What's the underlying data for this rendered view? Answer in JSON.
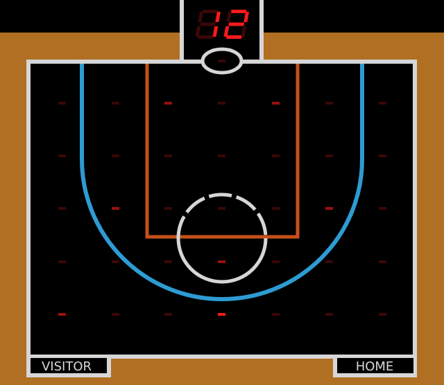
{
  "scoreboard": {
    "digits": [
      "1",
      "2"
    ],
    "lit_color": "#ff1a1a",
    "unlit_color": "#3a0707"
  },
  "teams": {
    "visitor_label": "VISITOR",
    "home_label": "HOME"
  },
  "colors": {
    "floor": "#b06f22",
    "court": "#000000",
    "boundary": "#d6d6d6",
    "three_point_arc": "#2e9bd3",
    "key_lane": "#c5501a",
    "led_dim": "#3a0707",
    "led_mid": "#9a1010",
    "led_bright": "#ff1a1a"
  },
  "led_grid": {
    "rows": [
      [
        "off",
        "off",
        "mid",
        "off",
        "mid",
        "off",
        "off"
      ],
      [
        "off",
        "off",
        "off",
        "off",
        "off",
        "off",
        "off"
      ],
      [
        "off",
        "mid",
        "off",
        "off",
        "off",
        "mid",
        "off"
      ],
      [
        "off",
        "off",
        "off",
        "mid",
        "off",
        "off",
        "off"
      ],
      [
        "mid",
        "off",
        "off",
        "bright",
        "off",
        "off",
        "off"
      ]
    ]
  }
}
